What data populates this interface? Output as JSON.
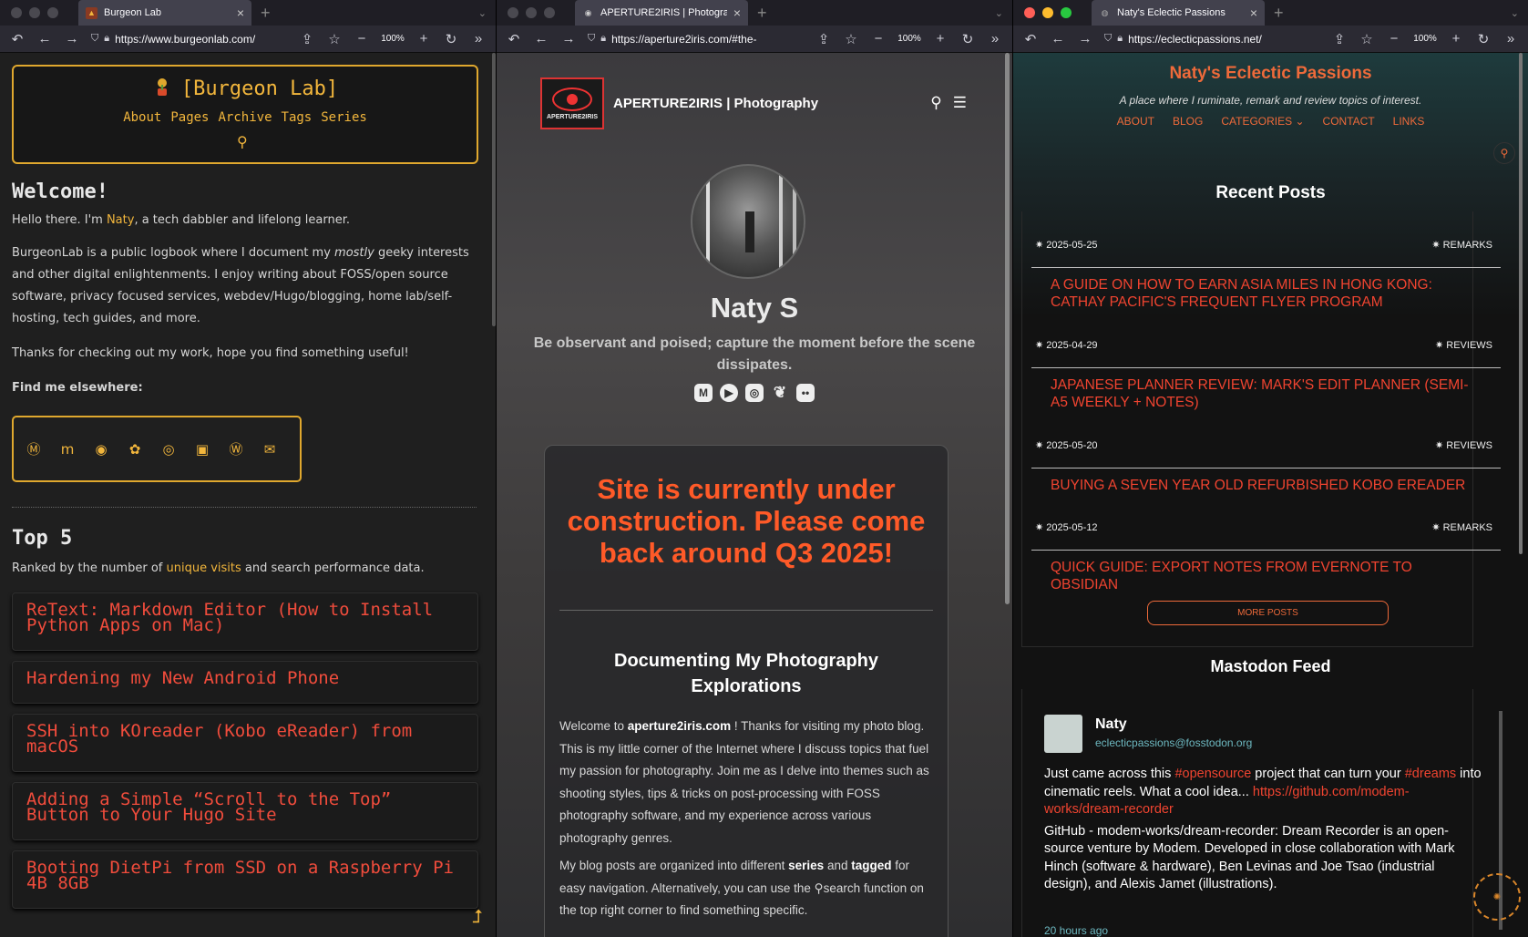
{
  "windows": [
    {
      "tab_title": "Burgeon Lab",
      "url": "https://www.burgeonlab.com/",
      "zoom": "100%"
    },
    {
      "tab_title": "APERTURE2IRIS | Photography",
      "url": "https://aperture2iris.com/#the-",
      "zoom": "100%"
    },
    {
      "tab_title": "Naty's Eclectic Passions",
      "url": "https://eclecticpassions.net/",
      "zoom": "100%"
    }
  ],
  "burgeon": {
    "title": "[Burgeon Lab]",
    "nav": [
      "About",
      "Pages",
      "Archive",
      "Tags",
      "Series"
    ],
    "welcome_heading": "Welcome!",
    "intro_pre": "Hello there. I'm ",
    "intro_link": "Naty",
    "intro_post": ", a tech dabbler and lifelong learner.",
    "p2_pre": "BurgeonLab is a public logbook where I document my ",
    "p2_em": "mostly",
    "p2_post": " geeky interests and other digital enlightenments. I enjoy writing about FOSS/open source software, privacy focused services, webdev/Hugo/blogging, home lab/self-hosting, tech guides, and more.",
    "p3": "Thanks for checking out my work, hope you find something useful!",
    "find_label": "Find me elsewhere:",
    "top_heading": "Top 5",
    "top_pre": "Ranked by the number of ",
    "top_link": "unique visits",
    "top_post": " and search performance data.",
    "top_posts": [
      "ReText: Markdown Editor (How to Install Python Apps on Mac)",
      "Hardening my New Android Phone",
      "SSH into KOreader (Kobo eReader) from macOS",
      "Adding a Simple “Scroll to the Top” Button to Your Hugo Site",
      "Booting DietPi from SSD on a Raspberry Pi 4B 8GB"
    ]
  },
  "aperture": {
    "logo_text": "APERTURE2IRIS",
    "site_name": "APERTURE2IRIS | Photography",
    "name": "Naty S",
    "tagline": "Be observant and poised; capture the moment before the scene dissipates.",
    "warning": "Site is currently under construction. Please come back around Q3 2025!",
    "section_heading": "Documenting My Photography Explorations",
    "p1_pre": "Welcome to ",
    "p1_b": "aperture2iris.com",
    "p1_post": " ! Thanks for visiting my photo blog. This is my little corner of the Internet where I discuss topics that fuel my passion for photography. Join me as I delve into themes such as shooting styles, tips & tricks on post-processing with FOSS photography software, and my experience across various photography genres.",
    "p2_a": "My blog posts are organized into different ",
    "p2_b1": "series",
    "p2_c": " and ",
    "p2_b2": "tagged",
    "p2_d": " for easy navigation. Alternatively, you can use the ",
    "p2_e": "search function on the top right corner to find something specific."
  },
  "eclectic": {
    "title": "Naty's Eclectic Passions",
    "subtitle": "A place where I ruminate, remark and review topics of interest.",
    "nav": [
      "ABOUT",
      "BLOG",
      "CATEGORIES ⌄",
      "CONTACT",
      "LINKS"
    ],
    "recent_heading": "Recent Posts",
    "posts": [
      {
        "date": "2025-05-25",
        "category": "REMARKS",
        "title": "A Guide on How to Earn Asia Miles in Hong Kong: Cathay Pacific's Frequent Flyer Program"
      },
      {
        "date": "2025-04-29",
        "category": "REVIEWS",
        "title": "Japanese Planner Review: Mark's Edit Planner (Semi-A5 Weekly + Notes)"
      },
      {
        "date": "2025-05-20",
        "category": "REVIEWS",
        "title": "Buying a Seven Year Old Refurbished Kobo eReader"
      },
      {
        "date": "2025-05-12",
        "category": "REMARKS",
        "title": "Quick Guide: Export Notes from Evernote to Obsidian"
      }
    ],
    "more_posts": "MORE POSTS",
    "mastodon_heading": "Mastodon Feed",
    "toot": {
      "user": "Naty",
      "handle": "eclecticpassions@fosstodon.org",
      "t1": "Just came across this ",
      "tag1": "#opensource",
      "t2": " project that can turn your ",
      "tag2": "#dreams",
      "t3": " into cinematic reels. What a cool idea... ",
      "link": "https://github.com/modem-works/dream-recorder",
      "card": "GitHub - modem-works/dream-recorder: Dream Recorder is an open-source venture by Modem. Developed in close collaboration with Mark Hinch (software & hardware), Ben Levinas and Joe Tsao (industrial design), and Alexis Jamet (illustrations).",
      "time": "20 hours ago"
    }
  }
}
